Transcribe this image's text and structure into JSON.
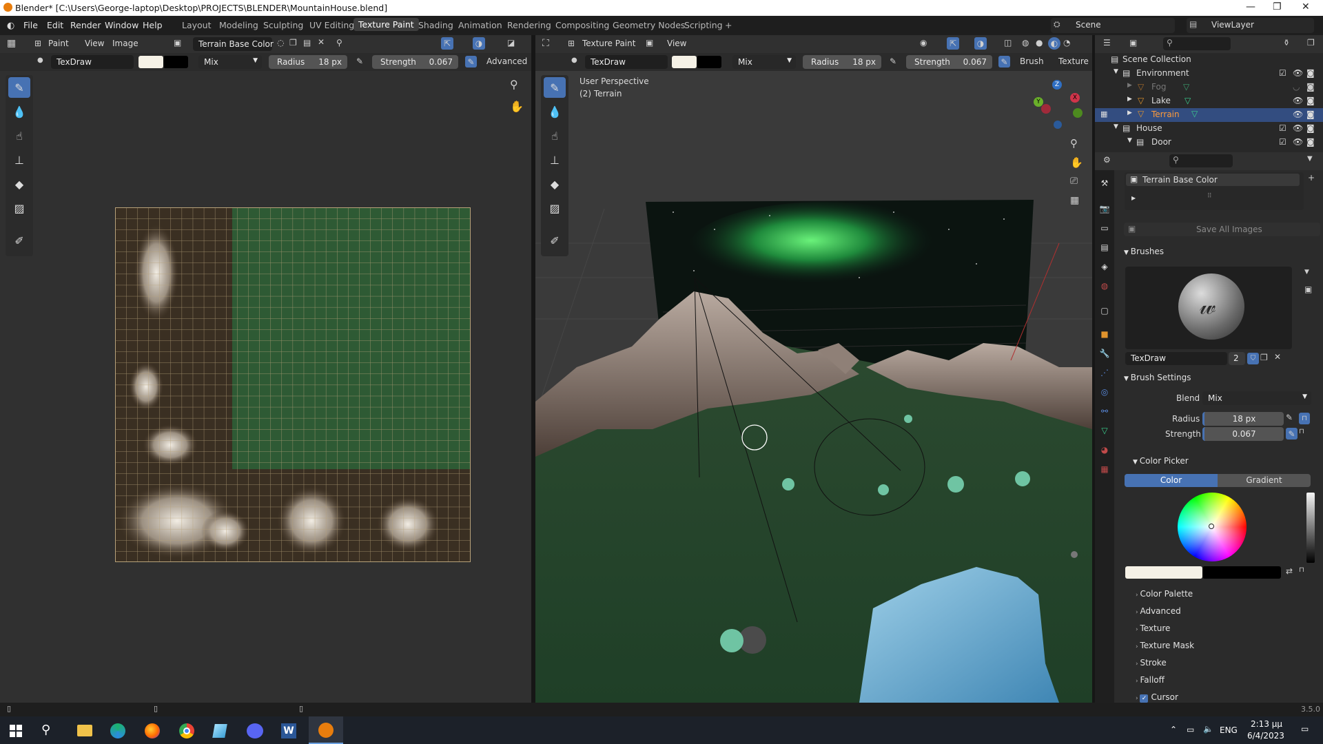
{
  "window": {
    "title": "Blender* [C:\\Users\\George-laptop\\Desktop\\PROJECTS\\BLENDER\\MountainHouse.blend]",
    "minimize": "—",
    "maximize": "❐",
    "close": "✕"
  },
  "menu": [
    "File",
    "Edit",
    "Render",
    "Window",
    "Help"
  ],
  "workspaces": [
    "Layout",
    "Modeling",
    "Sculpting",
    "UV Editing",
    "Texture Paint",
    "Shading",
    "Animation",
    "Rendering",
    "Compositing",
    "Geometry Nodes",
    "Scripting",
    "+"
  ],
  "active_workspace": "Texture Paint",
  "scene": "Scene",
  "view_layer": "ViewLayer",
  "image_editor": {
    "mode": "Paint",
    "menu": [
      "View",
      "Image"
    ],
    "image_name": "Terrain Base Color",
    "brush": "TexDraw",
    "blend": "Mix",
    "radius_label": "Radius",
    "radius": "18 px",
    "strength_label": "Strength",
    "strength": "0.067",
    "advanced": "Advanced"
  },
  "viewport": {
    "mode": "Texture Paint",
    "menu": [
      "View"
    ],
    "brush": "TexDraw",
    "blend": "Mix",
    "radius_label": "Radius",
    "radius": "18 px",
    "strength_label": "Strength",
    "strength": "0.067",
    "brush_menu": "Brush",
    "texture_menu": "Texture",
    "overlay_line1": "User Perspective",
    "overlay_line2": "(2) Terrain",
    "gizmo": {
      "z": "Z",
      "y": "Y",
      "x": "X"
    }
  },
  "outliner": {
    "root": "Scene Collection",
    "items": [
      {
        "name": "Environment",
        "level": 0,
        "kind": "collection"
      },
      {
        "name": "Fog",
        "level": 1,
        "kind": "object",
        "dim": true
      },
      {
        "name": "Lake",
        "level": 1,
        "kind": "object"
      },
      {
        "name": "Terrain",
        "level": 1,
        "kind": "object",
        "selected": true
      },
      {
        "name": "House",
        "level": 0,
        "kind": "collection"
      },
      {
        "name": "Door",
        "level": 1,
        "kind": "collection"
      }
    ]
  },
  "properties": {
    "image_slot": "Terrain Base Color",
    "save_all": "Save All Images",
    "brushes_header": "Brushes",
    "brush_name": "TexDraw",
    "brush_users": "2",
    "brush_settings_header": "Brush Settings",
    "blend_label": "Blend",
    "blend_value": "Mix",
    "radius_label": "Radius",
    "radius_value": "18 px",
    "strength_label": "Strength",
    "strength_value": "0.067",
    "color_picker_header": "Color Picker",
    "color_tab": "Color",
    "gradient_tab": "Gradient",
    "collapsed_panels": [
      "Color Palette",
      "Advanced",
      "Texture",
      "Texture Mask",
      "Stroke",
      "Falloff",
      "Cursor"
    ],
    "cursor_checked": true
  },
  "version": "3.5.0",
  "taskbar": {
    "apps": [
      "windows-start",
      "search",
      "file-explorer",
      "edge",
      "firefox",
      "chrome",
      "notepad",
      "discord",
      "word",
      "blender"
    ],
    "lang": "ENG",
    "time": "2:13 μμ",
    "date": "6/4/2023"
  },
  "colors": {
    "accent": "#4772b3",
    "primary_color": "#f5f1e6",
    "secondary_color": "#000000",
    "terrain_green": "#2e5a34"
  }
}
